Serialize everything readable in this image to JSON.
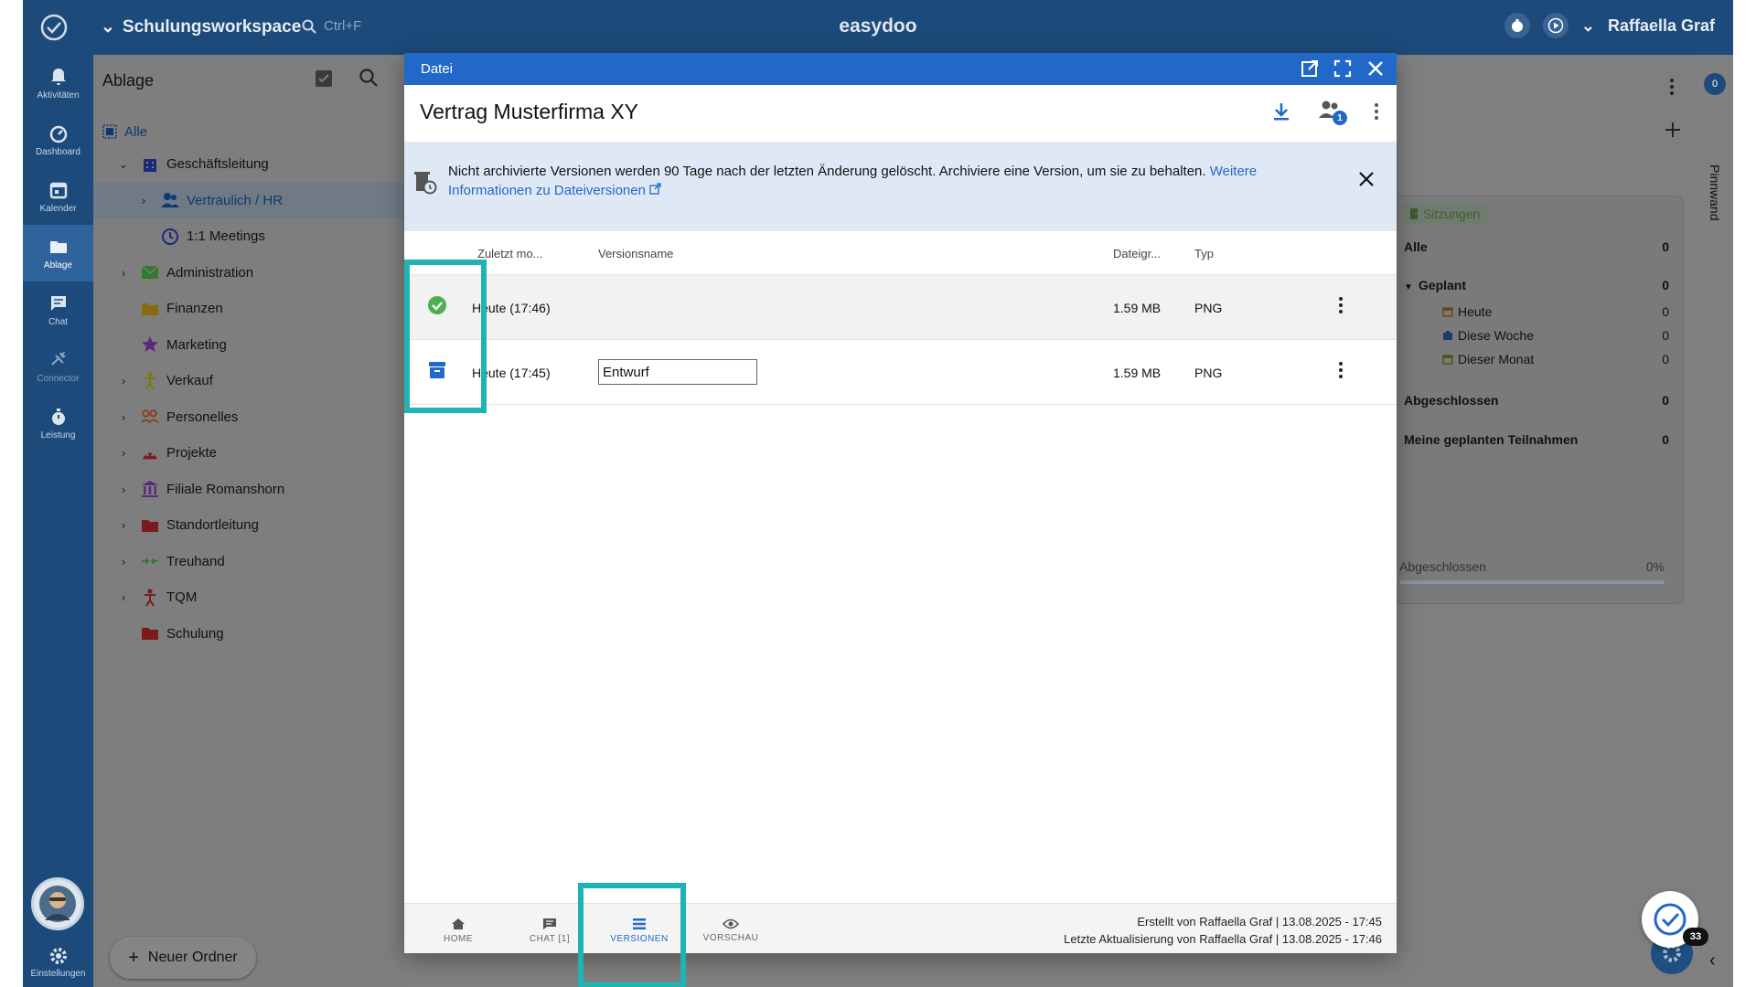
{
  "topbar": {
    "workspace": "Schulungsworkspace",
    "search_hint": "Ctrl+F",
    "app_title": "easydoo",
    "user_name": "Raffaella Graf"
  },
  "rail": {
    "items": [
      {
        "label": "Aktivitäten",
        "icon": "bell-icon"
      },
      {
        "label": "Dashboard",
        "icon": "dashboard-icon"
      },
      {
        "label": "Kalender",
        "icon": "calendar-icon"
      },
      {
        "label": "Ablage",
        "icon": "folder-icon",
        "active": true
      },
      {
        "label": "Chat",
        "icon": "chat-icon"
      },
      {
        "label": "Connector",
        "icon": "connector-icon"
      },
      {
        "label": "Leistung",
        "icon": "stopwatch-icon"
      }
    ],
    "settings_label": "Einstellungen"
  },
  "folders": {
    "title": "Ablage",
    "all_label": "Alle",
    "items": [
      {
        "label": "Geschäftsleitung",
        "level": 1,
        "expanded": true,
        "color": "#1c2a7a"
      },
      {
        "label": "Vertraulich / HR",
        "level": 2,
        "selected": true,
        "color": "#0d3970"
      },
      {
        "label": "1:1 Meetings",
        "level": 2,
        "color": "#1c2a7a"
      },
      {
        "label": "Administration",
        "level": 1,
        "color": "#2f7a2f"
      },
      {
        "label": "Finanzen",
        "level": 1,
        "color": "#8a6a10"
      },
      {
        "label": "Marketing",
        "level": 1,
        "color": "#5a2a7a"
      },
      {
        "label": "Verkauf",
        "level": 1,
        "color": "#7a7a10"
      },
      {
        "label": "Personelles",
        "level": 1,
        "color": "#8a3a10"
      },
      {
        "label": "Projekte",
        "level": 1,
        "color": "#7a1a1a"
      },
      {
        "label": "Filiale Romanshorn",
        "level": 1,
        "color": "#5a2a7a"
      },
      {
        "label": "Standortleitung",
        "level": 1,
        "color": "#7a1a1a"
      },
      {
        "label": "Treuhand",
        "level": 1,
        "color": "#2f7a2f"
      },
      {
        "label": "TQM",
        "level": 1,
        "color": "#7a1a1a"
      },
      {
        "label": "Schulung",
        "level": 1,
        "color": "#7a1a1a"
      }
    ],
    "new_folder_label": "Neuer Ordner"
  },
  "meetings": {
    "badge": "Sitzungen",
    "rows": [
      {
        "label": "Alle",
        "count": "0",
        "bold": true
      },
      {
        "label": "Geplant",
        "count": "0",
        "bold": true
      },
      {
        "label": "Heute",
        "count": "0"
      },
      {
        "label": "Diese Woche",
        "count": "0"
      },
      {
        "label": "Dieser Monat",
        "count": "0"
      },
      {
        "label": "Abgeschlossen",
        "count": "0",
        "bold": true
      },
      {
        "label": "Meine geplanten Teilnahmen",
        "count": "0",
        "bold": true
      }
    ],
    "progress_label": "Abgeschlossen",
    "progress_value": "0%"
  },
  "pinnwand": {
    "label": "Pinnwand",
    "count": "0"
  },
  "floating": {
    "count": "33"
  },
  "modal": {
    "bar_title": "Datei",
    "file_title": "Vertrag Musterfirma XY",
    "members_count": "1",
    "notice_text": "Nicht archivierte Versionen werden 90 Tage nach der letzten Änderung gelöscht. Archiviere eine Version, um sie zu behalten.",
    "notice_link": "Weitere Informationen zu Dateiversionen",
    "columns": {
      "modified": "Zuletzt mo...",
      "name": "Versionsname",
      "size": "Dateigr...",
      "type": "Typ"
    },
    "versions": [
      {
        "modified": "Heute (17:46)",
        "name": "",
        "size": "1.59 MB",
        "type": "PNG",
        "status": "current"
      },
      {
        "modified": "Heute (17:45)",
        "name": "Entwurf",
        "size": "1.59 MB",
        "type": "PNG",
        "status": "archived"
      }
    ],
    "tabs": [
      {
        "label": "HOME",
        "icon": "home-icon"
      },
      {
        "label": "CHAT [1]",
        "icon": "chat-icon"
      },
      {
        "label": "VERSIONEN",
        "icon": "list-icon",
        "active": true
      },
      {
        "label": "VORSCHAU",
        "icon": "eye-icon"
      }
    ],
    "created": "Erstellt von Raffaella Graf | 13.08.2025 - 17:45",
    "updated": "Letzte Aktualisierung von Raffaella Graf | 13.08.2025 - 17:46"
  },
  "colors": {
    "accent": "#2268c9",
    "topbar": "#1c4a7a",
    "highlight": "#1fb3b3",
    "success": "#4caf50"
  }
}
